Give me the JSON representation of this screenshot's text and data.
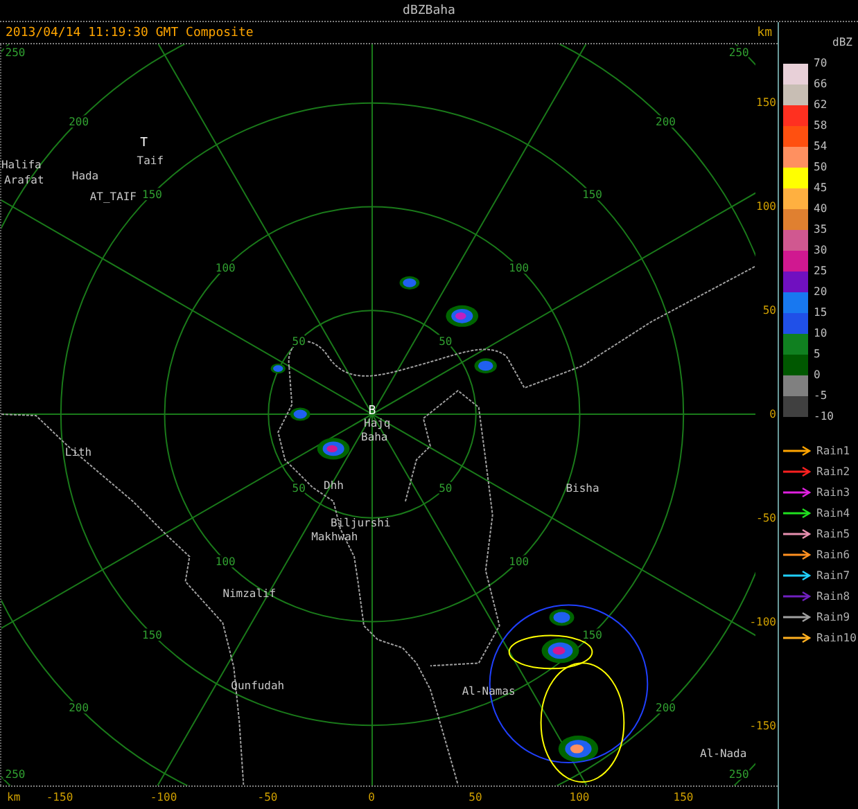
{
  "window": {
    "title": "dBZBaha"
  },
  "header": {
    "timestamp": "2013/04/14 11:19:30 GMT Composite",
    "axis_unit": "km"
  },
  "y_axis": {
    "ticks": [
      "150",
      "100",
      "50",
      "0",
      "-50",
      "-100",
      "-150"
    ]
  },
  "x_axis": {
    "unit": "km",
    "ticks": [
      "-150",
      "-100",
      "-50",
      "0",
      "50",
      "100",
      "150"
    ]
  },
  "range_rings": [
    {
      "labels": [
        "50",
        "50",
        "50",
        "50"
      ]
    },
    {
      "labels": [
        "100",
        "100",
        "100",
        "100"
      ]
    },
    {
      "labels": [
        "150",
        "150",
        "150",
        "150"
      ]
    },
    {
      "labels": [
        "200",
        "200",
        "200",
        "200"
      ]
    },
    {
      "labels": [
        "250",
        "250",
        "250",
        "250"
      ]
    }
  ],
  "places": [
    {
      "name": "Taif",
      "marker": "T"
    },
    {
      "name": "Halifa"
    },
    {
      "name": "Arafat"
    },
    {
      "name": "Hada"
    },
    {
      "name": "AT_TAIF"
    },
    {
      "name": "Lith"
    },
    {
      "name": "Hajq",
      "marker": "B"
    },
    {
      "name": "Baha"
    },
    {
      "name": "Dhh"
    },
    {
      "name": "Biljurshi"
    },
    {
      "name": "Makhwah"
    },
    {
      "name": "Bisha"
    },
    {
      "name": "Nimzalif"
    },
    {
      "name": "Qunfudah"
    },
    {
      "name": "Al-Namas"
    },
    {
      "name": "Al-Nada"
    }
  ],
  "legend": {
    "unit": "dBZ",
    "scale_labels": [
      "70",
      "66",
      "62",
      "58",
      "54",
      "50",
      "45",
      "40",
      "35",
      "30",
      "25",
      "20",
      "15",
      "10",
      "5",
      "0",
      "-5",
      "-10"
    ],
    "bins": [
      {
        "color": "#e8d0d8"
      },
      {
        "color": "#c8beb4"
      },
      {
        "color": "#ff3020"
      },
      {
        "color": "#ff5010"
      },
      {
        "color": "#ff9060"
      },
      {
        "color": "#ffff00"
      },
      {
        "color": "#ffb040"
      },
      {
        "color": "#e08030"
      },
      {
        "color": "#d05890"
      },
      {
        "color": "#d01890"
      },
      {
        "color": "#7010c0"
      },
      {
        "color": "#1878f0"
      },
      {
        "color": "#2050e8"
      },
      {
        "color": "#108020"
      },
      {
        "color": "#005800"
      },
      {
        "color": "#808080"
      },
      {
        "color": "#404040"
      }
    ],
    "tracks": [
      {
        "label": "Rain1",
        "color": "#ffa500"
      },
      {
        "label": "Rain2",
        "color": "#ff2020"
      },
      {
        "label": "Rain3",
        "color": "#e020e0"
      },
      {
        "label": "Rain4",
        "color": "#20e020"
      },
      {
        "label": "Rain5",
        "color": "#e890b0"
      },
      {
        "label": "Rain6",
        "color": "#ff9020"
      },
      {
        "label": "Rain7",
        "color": "#20d0ff"
      },
      {
        "label": "Rain8",
        "color": "#7020c0"
      },
      {
        "label": "Rain9",
        "color": "#a0a0a0"
      },
      {
        "label": "Rain10",
        "color": "#ffb020"
      }
    ]
  }
}
